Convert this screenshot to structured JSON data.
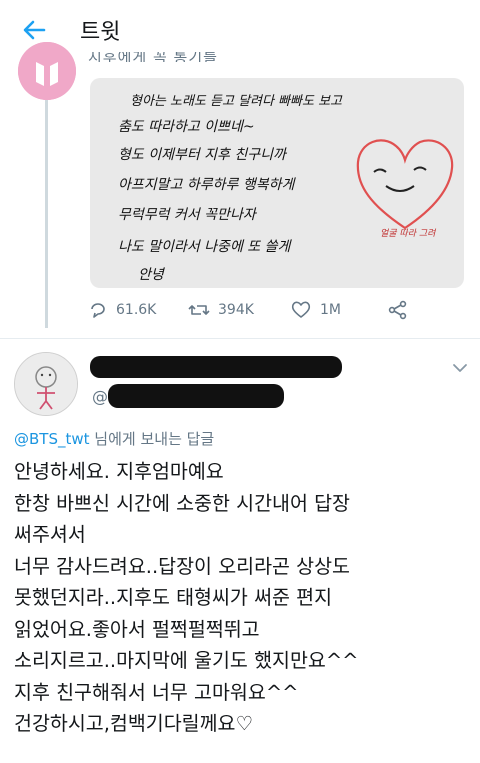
{
  "header": {
    "title": "트윗"
  },
  "prev_tweet": {
    "cut_text": "지후에게 꼭 통기를",
    "note_lines": [
      "형아는 노래도 듣고 달려다 빠빠도 보고",
      "춤도 따라하고 이쁘네~",
      "형도 이제부터 지후 친구니까",
      "아프지말고 하루하루 행복하게",
      "무럭무럭 커서 꼭만나자",
      "나도 말이라서 나중에 또 쓸게",
      "안녕"
    ],
    "heart_caption": "얼굴 따라 그려",
    "stats": {
      "replies": "61.6K",
      "retweets": "394K",
      "likes": "1M"
    }
  },
  "reply": {
    "handle_prefix": "@",
    "reply_to_mention": "@BTS_twt",
    "reply_to_suffix": "님에게 보내는 답글",
    "lines": [
      "안녕하세요. 지후엄마예요",
      "한창 바쁘신 시간에 소중한 시간내어 답장",
      "써주셔서",
      "너무 감사드려요..답장이 오리라곤 상상도",
      "못했던지라..지후도 태형씨가 써준 편지",
      "읽었어요.좋아서 펄쩍펄쩍뛰고",
      "소리지르고..마지막에 울기도 했지만요^^",
      "지후 친구해줘서 너무 고마워요^^",
      "건강하시고,컴백기다릴께요♡"
    ]
  },
  "colors": {
    "accent": "#1da1f2",
    "muted": "#657786",
    "avatar": "#f0a8c8",
    "heart": "#e05050"
  },
  "icons": [
    "back-arrow-icon",
    "reply-icon",
    "retweet-icon",
    "like-icon",
    "share-icon",
    "chevron-down-icon"
  ]
}
